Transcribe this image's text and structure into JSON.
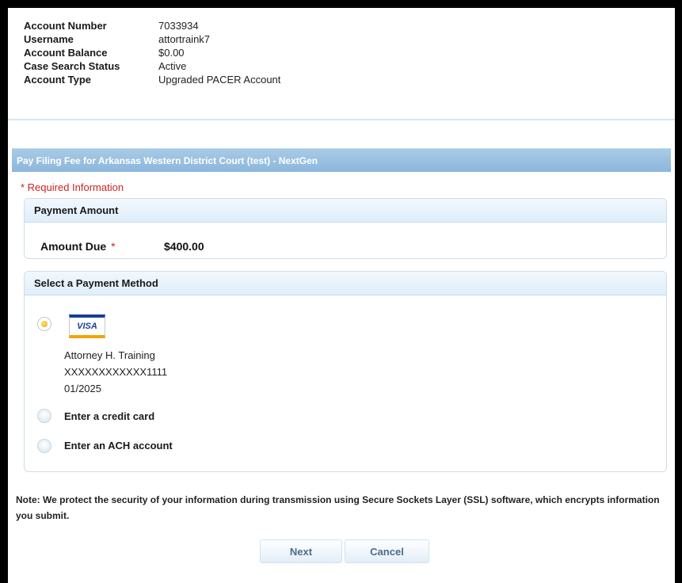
{
  "account": {
    "rows": [
      {
        "label": "Account Number",
        "value": "7033934"
      },
      {
        "label": "Username",
        "value": "attortraink7"
      },
      {
        "label": "Account Balance",
        "value": "$0.00"
      },
      {
        "label": "Case Search Status",
        "value": "Active"
      },
      {
        "label": "Account Type",
        "value": "Upgraded PACER Account"
      }
    ]
  },
  "title": "Pay Filing Fee for Arkansas Western District Court (test) - NextGen",
  "required_note": "* Required Information",
  "payment_amount": {
    "header": "Payment Amount",
    "amount_label": "Amount Due",
    "required_star": "*",
    "amount_value": "$400.00"
  },
  "payment_method": {
    "header": "Select a Payment Method",
    "saved_card": {
      "brand": "VISA",
      "holder": "Attorney H. Training",
      "number": "XXXXXXXXXXXX1111",
      "expiry": "01/2025",
      "selected": true
    },
    "options": [
      {
        "label": "Enter a credit card",
        "selected": false
      },
      {
        "label": "Enter an ACH account",
        "selected": false
      }
    ]
  },
  "note": "Note: We protect the security of your information during transmission using Secure Sockets Layer (SSL) software, which encrypts information you submit.",
  "buttons": {
    "next": "Next",
    "cancel": "Cancel"
  },
  "colors": {
    "title_bar": "#8cb6dc",
    "required": "#cc2222",
    "radio_selected": "#f0a800",
    "visa_blue": "#1a3f93"
  }
}
